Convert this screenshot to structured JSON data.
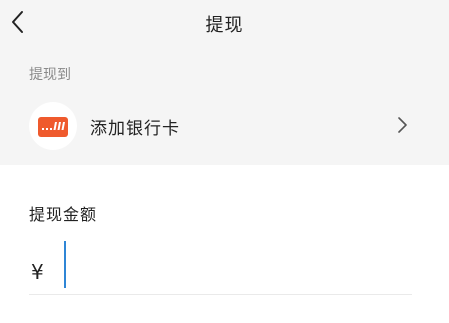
{
  "nav": {
    "title": "提现"
  },
  "withdraw_to": {
    "label": "提现到",
    "card_action_label": "添加银行卡"
  },
  "amount": {
    "label": "提现金额",
    "currency_symbol": "¥",
    "value": ""
  },
  "colors": {
    "top_background": "#f5f5f5",
    "card_icon": "#ef5a2d",
    "caret": "#2f86d6"
  },
  "icons": {
    "back": "chevron-left-icon",
    "card": "bank-card-icon",
    "row_chevron": "chevron-right-icon"
  }
}
